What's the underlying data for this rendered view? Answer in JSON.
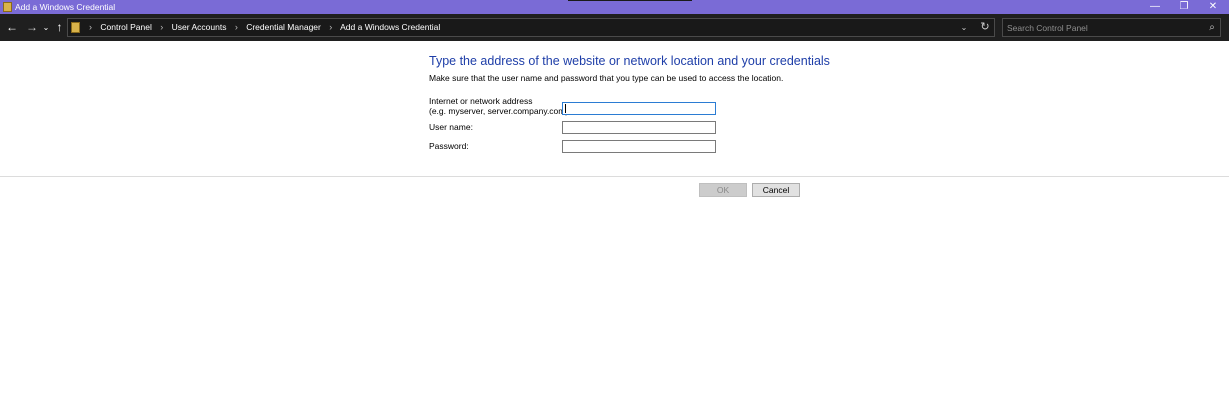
{
  "window": {
    "title": "Add a Windows Credential",
    "controls": {
      "minimize": "—",
      "restore": "❐",
      "close": "✕"
    }
  },
  "navigation": {
    "back": "←",
    "forward": "→",
    "recent": "⌄",
    "up": "↑",
    "breadcrumb": [
      "Control Panel",
      "User Accounts",
      "Credential Manager",
      "Add a Windows Credential"
    ],
    "separator": "›",
    "dropdown": "⌄",
    "refresh": "↻"
  },
  "search": {
    "placeholder": "Search Control Panel",
    "value": "",
    "icon": "⌕"
  },
  "form": {
    "heading": "Type the address of the website or network location and your credentials",
    "description": "Make sure that the user name and password that you type can be used to access the location.",
    "address_label_line1": "Internet or network address",
    "address_label_line2": "(e.g. myserver, server.company.com):",
    "address_value": "",
    "username_label": "User name:",
    "username_value": "",
    "password_label": "Password:",
    "password_value": ""
  },
  "buttons": {
    "ok": "OK",
    "cancel": "Cancel"
  },
  "colors": {
    "title_bar": "#7a6bd6",
    "address_bar": "#1f1f1f",
    "heading_text": "#1e3ea8",
    "focus_border": "#2b7cd3"
  }
}
